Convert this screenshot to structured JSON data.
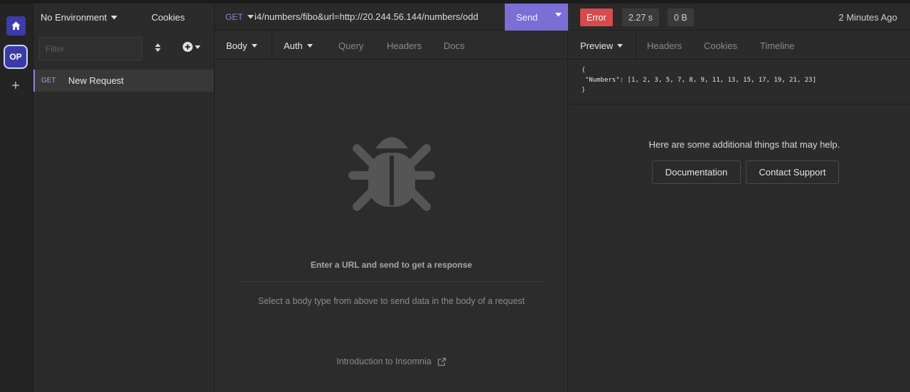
{
  "rail": {
    "workspace_initials": "OP",
    "add_symbol": "+"
  },
  "sidebar": {
    "environment_label": "No Environment",
    "cookies_label": "Cookies",
    "filter_placeholder": "Filter",
    "requests": [
      {
        "method": "GET",
        "name": "New Request"
      }
    ]
  },
  "request": {
    "method": "GET",
    "url": "i4/numbers/fibo&url=http://20.244.56.144/numbers/odd",
    "send_label": "Send",
    "tabs": [
      {
        "label": "Body",
        "has_dropdown": true
      },
      {
        "label": "Auth",
        "has_dropdown": true
      },
      {
        "label": "Query"
      },
      {
        "label": "Headers"
      },
      {
        "label": "Docs"
      }
    ],
    "empty_title": "Enter a URL and send to get a response",
    "empty_hint": "Select a body type from above to send data in the body of a request",
    "intro_link": "Introduction to Insomnia"
  },
  "response": {
    "status": "Error",
    "time": "2.27 s",
    "size": "0 B",
    "time_ago": "2 Minutes Ago",
    "tabs": [
      {
        "label": "Preview",
        "has_dropdown": true
      },
      {
        "label": "Headers"
      },
      {
        "label": "Cookies"
      },
      {
        "label": "Timeline"
      }
    ],
    "body_lines": [
      "{",
      "\"Numbers\": [1, 2, 3, 5, 7, 8, 9, 11, 13, 15, 17, 19, 21, 23]",
      "}"
    ],
    "help_text": "Here are some additional things that may help.",
    "documentation_label": "Documentation",
    "support_label": "Contact Support"
  },
  "colors": {
    "accent": "#7b6fd6",
    "error": "#d64b4b",
    "method_get": "#8d84e6",
    "workspace": "#3b3ba8"
  }
}
